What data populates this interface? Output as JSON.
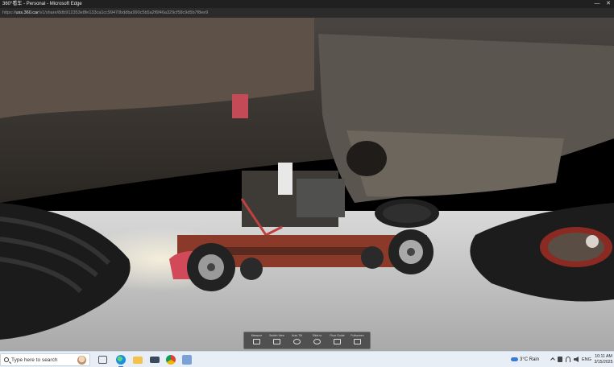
{
  "window": {
    "title": "360°看车 - Personal - Microsoft Edge",
    "controls": {
      "minimize": "—",
      "close": "✕"
    }
  },
  "address_bar": {
    "url_prefix": "https://",
    "url_domain": "uss.360.car",
    "url_path": "/v1/share/8db912353e8fe133ca1cc99470bddba990c5b5a2f6f46a329cf58c9d5b7f8ee9"
  },
  "viewer": {
    "content": "360° panorama of a vehicle underside",
    "toolbar": [
      {
        "label": "Measure",
        "icon": "ruler-icon"
      },
      {
        "label": "Switch View",
        "icon": "view-icon"
      },
      {
        "label": "Auto Tilt",
        "icon": "rotate-icon"
      },
      {
        "label": "Slide to",
        "icon": "pan-icon"
      },
      {
        "label": "Floor Guide",
        "icon": "guide-icon"
      },
      {
        "label": "Fullscreen",
        "icon": "fullscreen-icon"
      }
    ]
  },
  "taskbar": {
    "search_placeholder": "Type here to search",
    "weather": "3°C  Rain",
    "language": "ENG",
    "time": "10:11 AM",
    "date": "3/15/2025",
    "pinned": [
      "task-view",
      "edge",
      "file-explorer",
      "mail",
      "chrome",
      "store"
    ],
    "colors": {
      "taskbar_bg": "#e8eef5",
      "accent": "#2f7fd6"
    }
  }
}
